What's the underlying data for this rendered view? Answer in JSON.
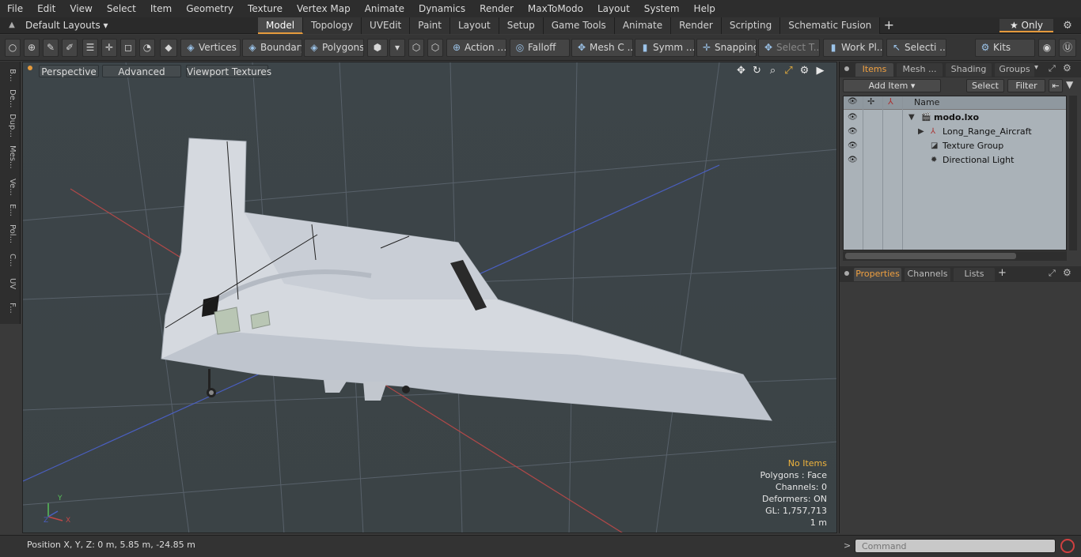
{
  "menu": [
    "File",
    "Edit",
    "View",
    "Select",
    "Item",
    "Geometry",
    "Texture",
    "Vertex Map",
    "Animate",
    "Dynamics",
    "Render",
    "MaxToModo",
    "Layout",
    "System",
    "Help"
  ],
  "layout": {
    "select_label": "Default Layouts ▾",
    "tabs": [
      "Model",
      "Topology",
      "UVEdit",
      "Paint",
      "Layout",
      "Setup",
      "Game Tools",
      "Animate",
      "Render",
      "Scripting",
      "Schematic Fusion"
    ],
    "active_tab": "Model",
    "add_tab": "+",
    "only_label": "★ Only"
  },
  "toolbar": {
    "vertices": "Vertices",
    "boundary": "Boundary",
    "polygons": "Polygons",
    "action": "Action",
    "falloff": "Falloff",
    "mesh_c": "Mesh C ...",
    "symm": "Symm ...",
    "snapping": "Snapping",
    "select_t": "Select T...",
    "work_pl": "Work Pl...",
    "selecti": "Selecti ...",
    "kits": "Kits"
  },
  "left_strip": [
    "B...",
    "De...",
    "Dup...",
    "Mes...",
    "Ve...",
    "E...",
    "Pol...",
    "C...",
    "UV",
    "F..."
  ],
  "viewport": {
    "perspective": "Perspective",
    "advanced": "Advanced",
    "textures": "Viewport Textures",
    "stats": {
      "no_items": "No Items",
      "polygons": "Polygons : Face",
      "channels": "Channels: 0",
      "deformers": "Deformers: ON",
      "gl": "GL: 1,757,713",
      "scale": "1 m"
    }
  },
  "items_panel": {
    "tabs": [
      "Items",
      "Mesh ...",
      "Shading",
      "Groups"
    ],
    "add_item": "Add Item",
    "select": "Select",
    "filter": "Filter",
    "name_header": "Name",
    "rows": [
      {
        "name": "modo.lxo"
      },
      {
        "name": "Long_Range_Aircraft"
      },
      {
        "name": "Texture Group"
      },
      {
        "name": "Directional Light"
      }
    ]
  },
  "props_panel": {
    "tabs": [
      "Properties",
      "Channels",
      "Lists"
    ],
    "add": "+"
  },
  "status": {
    "position": "Position X, Y, Z:   0 m, 5.85 m, -24.85 m"
  },
  "command": {
    "placeholder": "Command",
    "prompt": ">"
  },
  "colors": {
    "accent": "#e59a3c",
    "viewport_bg": "#3c4448",
    "warning": "#f0b43c"
  }
}
